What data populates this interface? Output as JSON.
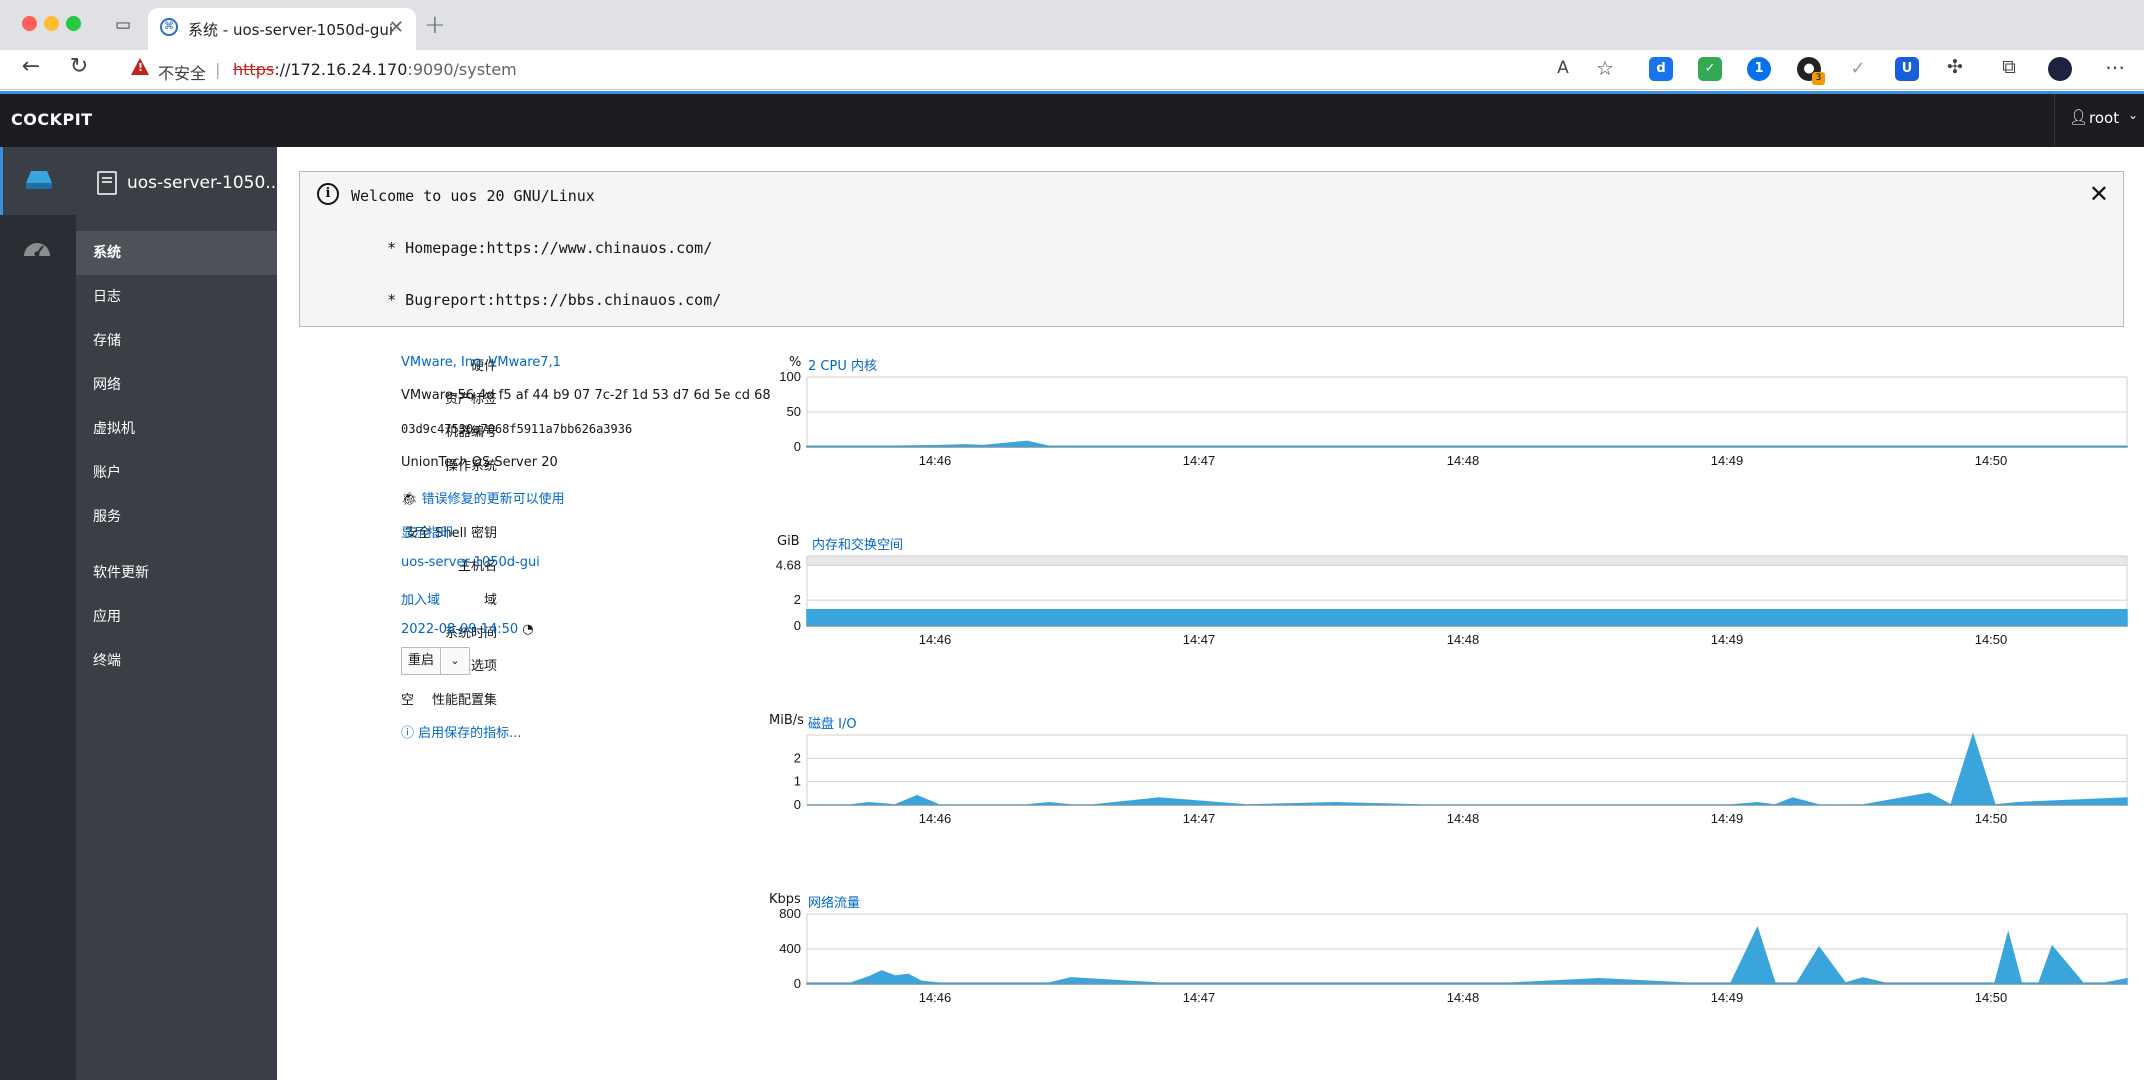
{
  "browser": {
    "tab_title": "系统 - uos-server-1050d-gui",
    "insecure_label": "不安全",
    "url_scheme": "https",
    "url_host": "://172.16.24.170",
    "url_rest": ":9090/system",
    "colors": {
      "close": "#ff5f57",
      "minimize": "#febc2e",
      "maximize": "#28c840"
    },
    "extension_badge": "3"
  },
  "header": {
    "brand": "COCKPIT",
    "user": "root"
  },
  "sidebar": {
    "host": "uos-server-1050...",
    "items": [
      {
        "label": "系统",
        "active": true
      },
      {
        "label": "日志"
      },
      {
        "label": "存储"
      },
      {
        "label": "网络"
      },
      {
        "label": "虚拟机"
      },
      {
        "label": "账户"
      },
      {
        "label": "服务"
      },
      {
        "label": "软件更新"
      },
      {
        "label": "应用"
      },
      {
        "label": "终端"
      }
    ]
  },
  "motd": {
    "line1": "Welcome to uos 20 GNU/Linux",
    "line2": "    * Homepage:https://www.chinauos.com/",
    "line3": "    * Bugreport:https://bbs.chinauos.com/"
  },
  "system_info": {
    "hardware_label": "硬件",
    "hardware_value": "VMware, Inc. VMware7,1",
    "asset_label": "资产标签",
    "asset_value": "VMware-56 4d f5 af 44 b9 07 7c-2f 1d 53 d7 6d 5e cd 68",
    "machine_id_label": "机器编号",
    "machine_id_value": "03d9c47530a7068f5911a7bb626a3936",
    "os_label": "操作系统",
    "os_value": "UnionTech OS Server 20",
    "updates_link": "错误修复的更新可以使用",
    "ssh_label": "安全 Shell 密钥",
    "ssh_value": "显示指印",
    "hostname_label": "主机名",
    "hostname_value": "uos-server-1050d-gui",
    "domain_label": "域",
    "domain_value": "加入域",
    "time_label": "系统时间",
    "time_value": "2022-08-09 14:50",
    "power_label": "电源选项",
    "power_button": "重启",
    "profile_label": "性能配置集",
    "profile_value": "空",
    "metrics_link": "启用保存的指标..."
  },
  "charts_meta": {
    "accent": "#39a5dc",
    "link": "#0066cc"
  },
  "chart_data": [
    {
      "type": "area",
      "unit": "%",
      "title": "2 CPU 内核",
      "ylim": [
        0,
        100
      ],
      "yticks": [
        0,
        50,
        100
      ],
      "xticks": [
        "14:46",
        "14:47",
        "14:48",
        "14:49",
        "14:50"
      ],
      "xlim": [
        0,
        300
      ],
      "x": [
        0,
        10,
        20,
        30,
        36,
        40,
        45,
        50,
        55,
        60,
        80,
        100,
        120,
        140,
        160,
        180,
        200,
        210,
        220,
        230,
        240,
        250,
        260,
        270,
        280,
        285,
        290,
        295,
        300
      ],
      "values": [
        1,
        1,
        1,
        2,
        3,
        2,
        5,
        8,
        1,
        1,
        1,
        1,
        1,
        1,
        1,
        1,
        1,
        1,
        1,
        1,
        1,
        1,
        1,
        1,
        1,
        1,
        1,
        1,
        1
      ]
    },
    {
      "type": "area",
      "unit": "GiB",
      "title": "内存和交换空间",
      "ylim": [
        0,
        5.4
      ],
      "yticks": [
        0,
        2,
        4.68
      ],
      "ytick_labels": [
        "0",
        "2",
        "4.68"
      ],
      "capacity": 4.68,
      "xticks": [
        "14:46",
        "14:47",
        "14:48",
        "14:49",
        "14:50"
      ],
      "xlim": [
        0,
        300
      ],
      "x": [
        0,
        300
      ],
      "values": [
        1.25,
        1.25
      ]
    },
    {
      "type": "area",
      "unit": "MiB/s",
      "title": "磁盘 I/O",
      "ylim": [
        0,
        3
      ],
      "yticks": [
        0,
        1,
        2
      ],
      "xticks": [
        "14:46",
        "14:47",
        "14:48",
        "14:49",
        "14:50"
      ],
      "xlim": [
        0,
        300
      ],
      "x": [
        0,
        10,
        14,
        20,
        25,
        30,
        35,
        40,
        50,
        55,
        60,
        65,
        80,
        100,
        120,
        140,
        160,
        180,
        200,
        210,
        216,
        220,
        224,
        230,
        240,
        255,
        260,
        265,
        270,
        275,
        300
      ],
      "values": [
        0,
        0,
        0.1,
        0,
        0.4,
        0,
        0,
        0,
        0,
        0.1,
        0,
        0,
        0.3,
        0,
        0.1,
        0,
        0,
        0,
        0,
        0,
        0.1,
        0,
        0.3,
        0,
        0,
        0.5,
        0,
        3,
        0,
        0.1,
        0.3
      ]
    },
    {
      "type": "area",
      "unit": "Kbps",
      "title": "网络流量",
      "ylim": [
        0,
        800
      ],
      "yticks": [
        0,
        400,
        800
      ],
      "xticks": [
        "14:46",
        "14:47",
        "14:48",
        "14:49",
        "14:50"
      ],
      "xlim": [
        0,
        300
      ],
      "x": [
        0,
        10,
        14,
        17,
        20,
        23,
        26,
        30,
        55,
        60,
        80,
        100,
        120,
        140,
        160,
        180,
        200,
        210,
        216,
        220,
        225,
        230,
        236,
        240,
        245,
        270,
        273,
        276,
        280,
        283,
        290,
        295,
        300
      ],
      "values": [
        10,
        10,
        80,
        150,
        90,
        110,
        30,
        10,
        10,
        70,
        10,
        10,
        10,
        10,
        10,
        60,
        10,
        10,
        640,
        10,
        10,
        420,
        10,
        70,
        10,
        10,
        580,
        10,
        10,
        430,
        10,
        10,
        60
      ]
    }
  ]
}
